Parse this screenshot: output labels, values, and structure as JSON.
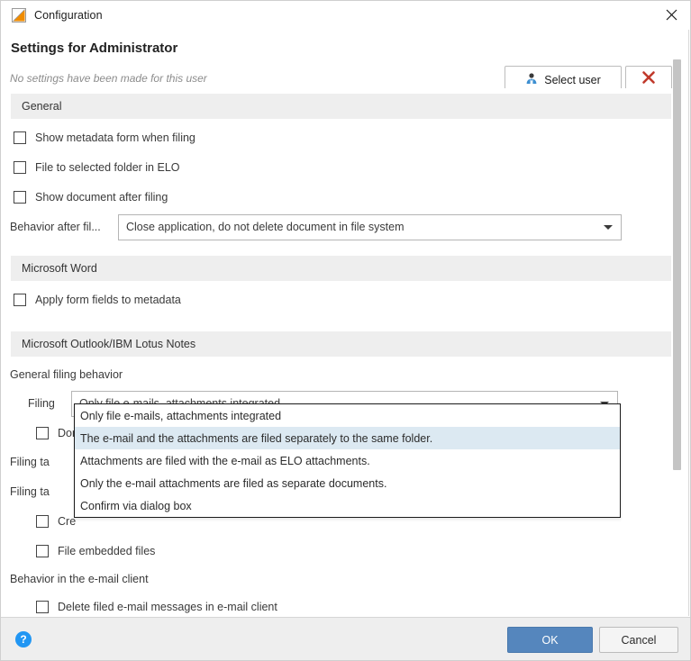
{
  "window": {
    "title": "Configuration",
    "icon": "elo-logo-icon",
    "close_icon": "close-icon"
  },
  "header": {
    "title": "Settings for Administrator",
    "subtitle": "No settings have been made for this user",
    "select_user_label": "Select user",
    "select_user_icon": "user-icon",
    "clear_user_icon": "red-x-icon"
  },
  "sections": {
    "general": {
      "header": "General",
      "checkboxes": [
        {
          "label": "Show metadata form when filing",
          "checked": false
        },
        {
          "label": "File to selected folder in ELO",
          "checked": false
        },
        {
          "label": "Show document after filing",
          "checked": false
        }
      ],
      "behavior_combo": {
        "label": "Behavior after fil...",
        "value": "Close application, do not delete document in file system"
      }
    },
    "word": {
      "header": "Microsoft Word",
      "checkboxes": [
        {
          "label": "Apply form fields to metadata",
          "checked": false
        }
      ]
    },
    "outlook": {
      "header": "Microsoft Outlook/IBM Lotus Notes",
      "group_filing_label": "General filing behavior",
      "filing_combo": {
        "label": "Filing",
        "value": "Only file e-mails, attachments integrated",
        "expanded": true,
        "options": [
          "Only file e-mails, attachments integrated",
          "The e-mail and the attachments are filed separately to the same folder.",
          "Attachments are filed with the e-mail as ELO attachments.",
          "Only the e-mail attachments are filed as separate documents.",
          "Confirm via dialog box"
        ],
        "highlighted_index": 1
      },
      "obscured_rows": [
        {
          "type": "checkbox",
          "label": "Don"
        },
        {
          "type": "label",
          "label": "Filing ta"
        },
        {
          "type": "label",
          "label": "Filing ta"
        },
        {
          "type": "checkbox",
          "label": "Cre"
        }
      ],
      "checkbox_file_embedded": {
        "label": "File embedded files",
        "checked": false
      },
      "group_client_label": "Behavior in the e-mail client",
      "checkbox_delete_filed": {
        "label": "Delete filed e-mail messages in e-mail client",
        "checked": false
      }
    }
  },
  "footer": {
    "help_icon": "help-icon",
    "help_glyph": "?",
    "ok_label": "OK",
    "cancel_label": "Cancel"
  },
  "scrollbar": {
    "orientation": "vertical"
  },
  "colors": {
    "accent": "#5586bd",
    "section_header_bg": "#eeeeee",
    "highlight_bg": "#dce9f2",
    "close_red": "#c0392b"
  }
}
